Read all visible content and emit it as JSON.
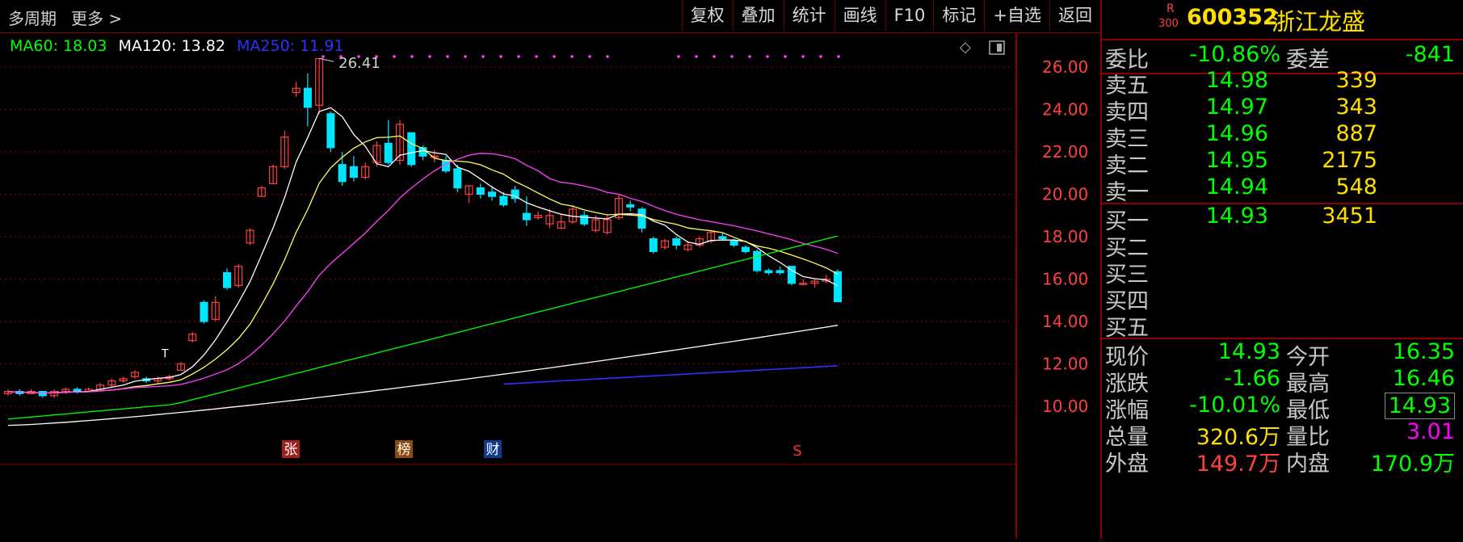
{
  "topbar": {
    "multi_period": "多周期",
    "more": "更多 >",
    "buttons": [
      "复权",
      "叠加",
      "统计",
      "画线",
      "F10",
      "标记",
      "+自选",
      "返回"
    ]
  },
  "ma_legend": {
    "ma60": "MA60: 18.03",
    "ma120": "MA120: 13.82",
    "ma250": "MA250: 11.91"
  },
  "colors": {
    "ma60": "#00ff00",
    "ma120": "#ffffff",
    "ma250": "#3030ff",
    "ma5": "#ffffff",
    "ma10": "#ffff60",
    "ma20": "#ff40ff",
    "up": "#ff4040",
    "down": "#00e5ff",
    "grid": "#8a0000"
  },
  "chart_data": {
    "type": "candlestick",
    "y_ticks": [
      "26.00",
      "24.00",
      "22.00",
      "20.00",
      "18.00",
      "16.00",
      "14.00",
      "12.00",
      "10.00"
    ],
    "high_annotation": "26.41",
    "markers": [
      "张",
      "榜",
      "财",
      "S"
    ],
    "icons": [
      "diamond-icon",
      "window-icon"
    ]
  },
  "quote": {
    "badge_r": "R",
    "badge_num": "300",
    "code": "600352",
    "name": "浙江龙盛",
    "weibi_label": "委比",
    "weibi_value": "-10.86%",
    "weicha_label": "委差",
    "weicha_value": "-841",
    "asks": [
      {
        "label": "卖五",
        "price": "14.98",
        "vol": "339"
      },
      {
        "label": "卖四",
        "price": "14.97",
        "vol": "343"
      },
      {
        "label": "卖三",
        "price": "14.96",
        "vol": "887"
      },
      {
        "label": "卖二",
        "price": "14.95",
        "vol": "2175"
      },
      {
        "label": "卖一",
        "price": "14.94",
        "vol": "548"
      }
    ],
    "bids": [
      {
        "label": "买一",
        "price": "14.93",
        "vol": "3451"
      },
      {
        "label": "买二",
        "price": "",
        "vol": ""
      },
      {
        "label": "买三",
        "price": "",
        "vol": ""
      },
      {
        "label": "买四",
        "price": "",
        "vol": ""
      },
      {
        "label": "买五",
        "price": "",
        "vol": ""
      }
    ],
    "stats": [
      {
        "l1": "现价",
        "v1": "14.93",
        "l2": "今开",
        "v2": "16.35"
      },
      {
        "l1": "涨跌",
        "v1": "-1.66",
        "l2": "最高",
        "v2": "16.46"
      },
      {
        "l1": "涨幅",
        "v1": "-10.01%",
        "l2": "最低",
        "v2": "14.93"
      },
      {
        "l1": "总量",
        "v1": "320.6万",
        "l2": "量比",
        "v2": "3.01"
      },
      {
        "l1": "外盘",
        "v1": "149.7万",
        "l2": "内盘",
        "v2": "170.9万"
      }
    ]
  }
}
